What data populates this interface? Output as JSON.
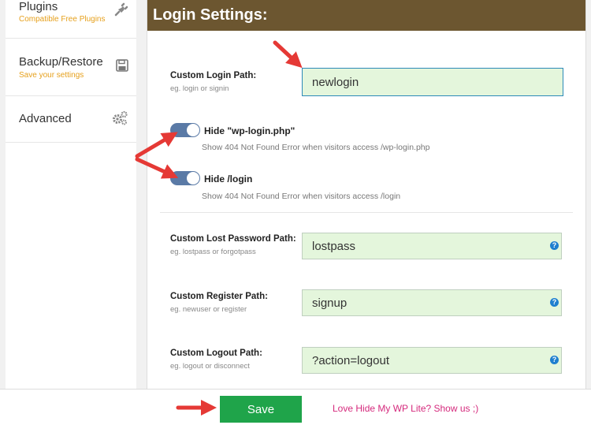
{
  "sidebar": {
    "items": [
      {
        "title": "Plugins",
        "subtitle": "Compatible Free Plugins",
        "icon": "plug-icon"
      },
      {
        "title": "Backup/Restore",
        "subtitle": "Save your settings",
        "icon": "floppy-disk-icon"
      },
      {
        "title": "Advanced",
        "subtitle": "",
        "icon": "gears-icon"
      }
    ]
  },
  "panel": {
    "title": "Login Settings:",
    "login_path": {
      "label": "Custom Login Path:",
      "hint": "eg. login or signin",
      "value": "newlogin"
    },
    "toggles": [
      {
        "label": "Hide \"wp-login.php\"",
        "hint": "Show 404 Not Found Error when visitors access /wp-login.php",
        "on": true
      },
      {
        "label": "Hide /login",
        "hint": "Show 404 Not Found Error when visitors access /login",
        "on": true
      }
    ],
    "lost_password": {
      "label": "Custom Lost Password Path:",
      "hint": "eg. lostpass or forgotpass",
      "value": "lostpass"
    },
    "register": {
      "label": "Custom Register Path:",
      "hint": "eg. newuser or register",
      "value": "signup"
    },
    "logout": {
      "label": "Custom Logout Path:",
      "hint": "eg. logout or disconnect",
      "value": "?action=logout"
    },
    "help_glyph": "?"
  },
  "footer": {
    "save_label": "Save",
    "promo_text": "Love Hide My WP Lite? Show us ;)"
  },
  "colors": {
    "header_bg": "#6c5630",
    "input_bg": "#e4f6dc",
    "save_bg": "#1fa44a",
    "accent_orange": "#e6a01c",
    "promo_pink": "#d52a7d",
    "toggle_on": "#5a7aa6",
    "arrow_red": "#e53935"
  }
}
